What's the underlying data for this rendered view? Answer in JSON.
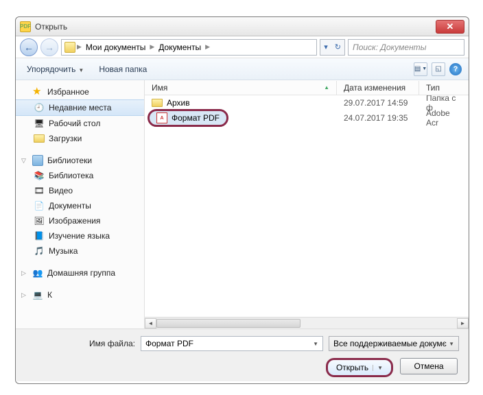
{
  "window": {
    "title": "Открыть"
  },
  "breadcrumb": {
    "seg1": "Мои документы",
    "seg2": "Документы"
  },
  "search": {
    "placeholder": "Поиск: Документы"
  },
  "toolbar": {
    "organize": "Упорядочить",
    "newfolder": "Новая папка"
  },
  "sidebar": {
    "favorites": {
      "head": "Избранное",
      "recent": "Недавние места",
      "desktop": "Рабочий стол",
      "downloads": "Загрузки"
    },
    "libraries": {
      "head": "Библиотеки",
      "lib": "Библиотека",
      "video": "Видео",
      "docs": "Документы",
      "images": "Изображения",
      "lang": "Изучение языка",
      "music": "Музыка"
    },
    "homegroup": {
      "head": "Домашняя группа"
    },
    "computer_initial": "К"
  },
  "columns": {
    "name": "Имя",
    "date": "Дата изменения",
    "type": "Тип"
  },
  "files": [
    {
      "name": "Архив",
      "date": "29.07.2017 14:59",
      "type": "Папка с ф"
    },
    {
      "name": "Формат PDF",
      "date": "24.07.2017 19:35",
      "type": "Adobe Acr"
    }
  ],
  "bottom": {
    "filename_label": "Имя файла:",
    "filename_value": "Формат PDF",
    "filter": "Все поддерживаемые докумє",
    "open": "Открыть",
    "cancel": "Отмена"
  }
}
